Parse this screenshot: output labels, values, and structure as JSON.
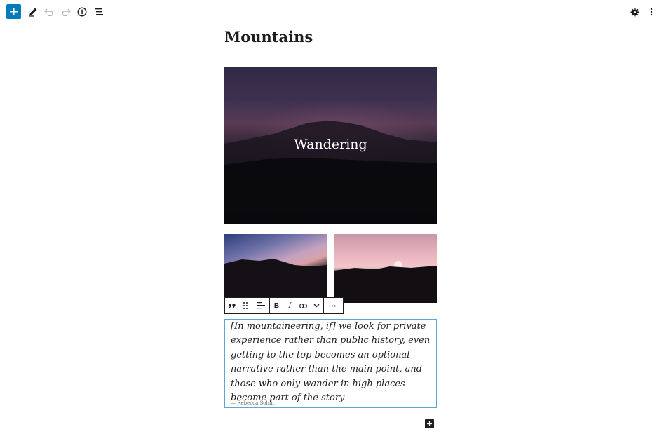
{
  "post": {
    "title": "Mountains",
    "cover_text": "Wandering"
  },
  "quote": {
    "text": "[In mountaineering, if] we look for private experience rather than public history, even getting to the top becomes an optional narrative rather than the main point, and those who only wander in high places become part of the story",
    "citation": "— Rebecca Solnit"
  },
  "toolbar": {
    "icons": [
      "plus-icon",
      "pencil-icon",
      "undo-icon",
      "redo-icon",
      "info-icon",
      "list-view-icon",
      "gear-icon",
      "more-vertical-icon"
    ]
  },
  "block_toolbar": {
    "bold_label": "B",
    "italic_label": "I",
    "icons": [
      "quote-icon",
      "drag-handle-icon",
      "align-icon",
      "bold-icon",
      "italic-icon",
      "link-icon",
      "chevron-down-icon",
      "more-horizontal-icon"
    ]
  },
  "colors": {
    "accent": "#007cba",
    "selection_border": "#5aa7d8",
    "text": "#1e1e1e"
  }
}
